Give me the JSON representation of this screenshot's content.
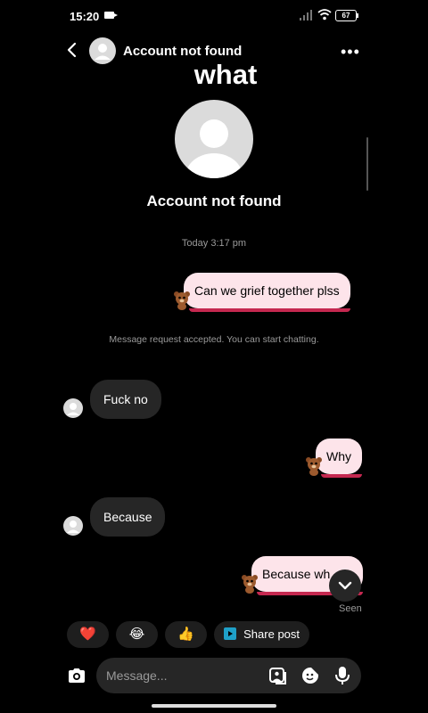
{
  "status_bar": {
    "time": "15:20",
    "battery": "67"
  },
  "header": {
    "title": "Account not found"
  },
  "caption": "what",
  "profile": {
    "name": "Account not found"
  },
  "timestamp": "Today 3:17 pm",
  "system_message": "Message request accepted. You can start chatting.",
  "messages": [
    {
      "text": "Can we grief together plss",
      "from": "me"
    },
    {
      "text": "Fuck no",
      "from": "them"
    },
    {
      "text": "Why",
      "from": "me"
    },
    {
      "text": "Because",
      "from": "them"
    },
    {
      "text": "Because wh",
      "from": "me"
    }
  ],
  "seen_label": "Seen",
  "quick_reactions": {
    "items": [
      "❤️",
      "😂",
      "👍"
    ],
    "share_label": "Share post"
  },
  "composer": {
    "placeholder": "Message..."
  },
  "colors": {
    "outgoing_bubble": "#fde4ea",
    "bubble_shadow": "#c52850",
    "incoming_bubble": "#262626",
    "background": "#000000"
  }
}
